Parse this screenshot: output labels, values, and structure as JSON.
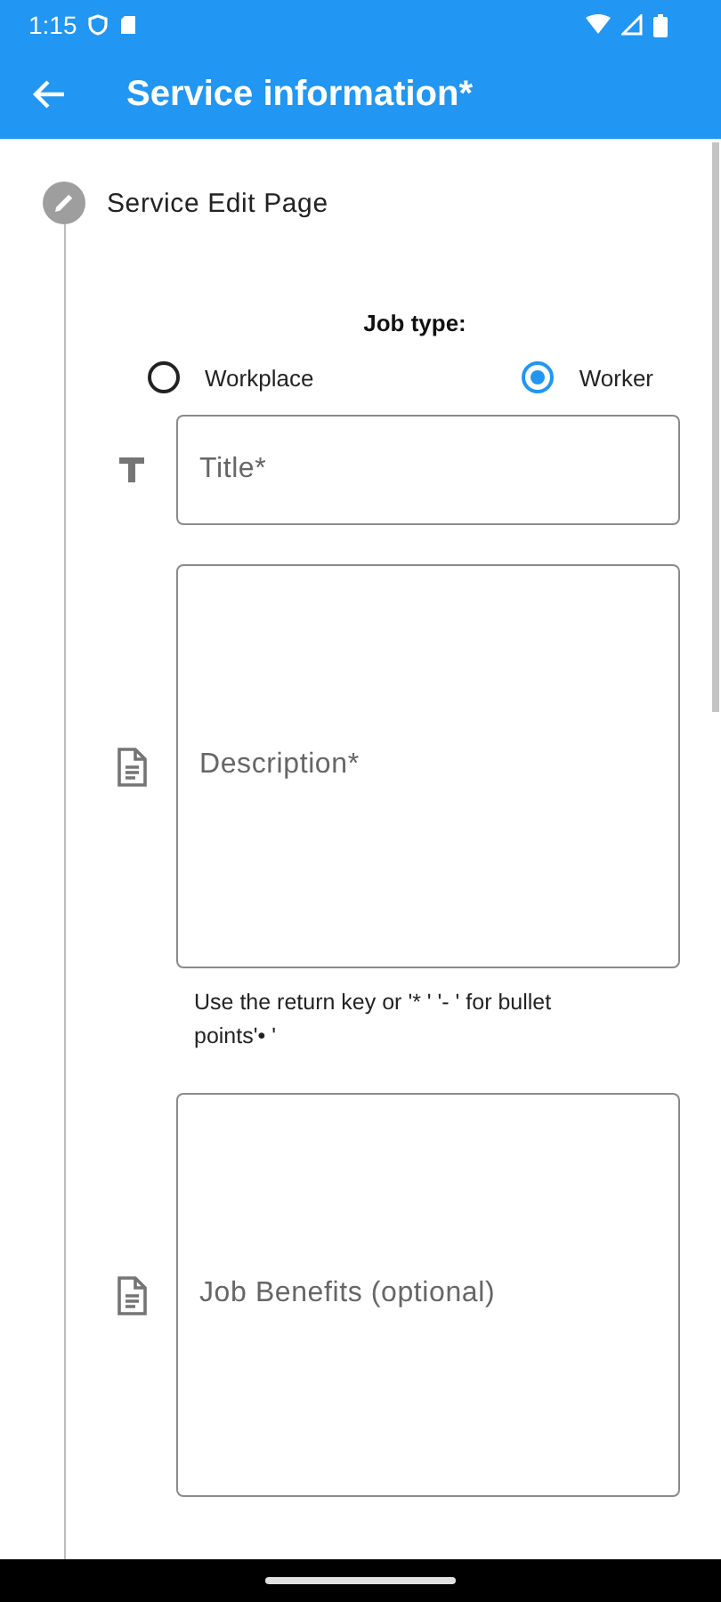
{
  "status_bar": {
    "time": "1:15"
  },
  "app_bar": {
    "title": "Service information*"
  },
  "step": {
    "title": "Service Edit Page"
  },
  "job_type": {
    "label": "Job type:",
    "options": [
      {
        "label": "Workplace",
        "selected": false
      },
      {
        "label": "Worker",
        "selected": true
      }
    ]
  },
  "fields": [
    {
      "kind": "single_line",
      "placeholder": "Title*"
    },
    {
      "kind": "multi_line",
      "placeholder": "Description*",
      "helper": "Use the return key or '* ' '- ' for bullet points'• '"
    },
    {
      "kind": "multi_line",
      "placeholder": "Job Benefits (optional)"
    }
  ]
}
